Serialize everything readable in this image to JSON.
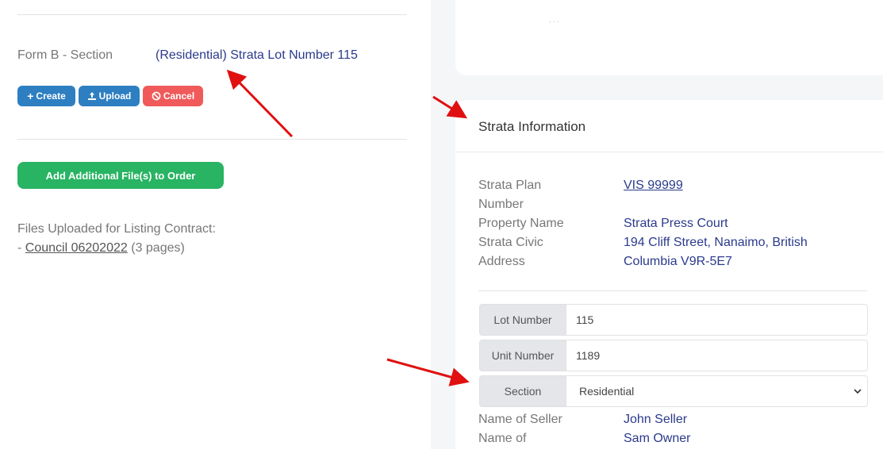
{
  "left": {
    "form_label": "Form B - Section",
    "form_value": "(Residential) Strata Lot Number 115",
    "buttons": {
      "create": "Create",
      "upload": "Upload",
      "cancel": "Cancel"
    },
    "add_files": "Add Additional File(s) to Order",
    "files_title": "Files Uploaded for Listing Contract:",
    "files": [
      {
        "prefix": "- ",
        "name": "Council 06202022",
        "pages": "(3 pages)"
      }
    ]
  },
  "card_top": {
    "dots": "..."
  },
  "strata": {
    "title": "Strata Information",
    "rows": [
      {
        "label_line1": "Strata Plan",
        "label_line2": "Number",
        "value": "VIS 99999"
      },
      {
        "label_line1": "Property Name",
        "value": "Strata Press Court"
      },
      {
        "label_line1": "Strata Civic",
        "label_line2": "Address",
        "value_line1": "194 Cliff Street, Nanaimo, British",
        "value_line2": "Columbia V9R-5E7"
      }
    ],
    "inputs": {
      "lot_label": "Lot Number",
      "lot_value": "115",
      "unit_label": "Unit Number",
      "unit_value": "1189",
      "section_label": "Section",
      "section_value": "Residential"
    },
    "seller_label": "Name of Seller",
    "seller_value": "John Seller",
    "owner_label": "Name of",
    "owner_value": "Sam Owner"
  },
  "colors": {
    "accent_blue": "#2d7fc1",
    "danger": "#f05a5a",
    "success": "#28b463",
    "link_navy": "#2b3a8c",
    "annotation_arrow": "#e01010"
  }
}
